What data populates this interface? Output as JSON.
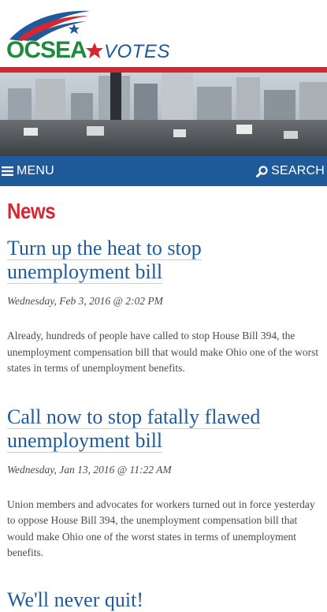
{
  "logo": {
    "text_left": "OCSEA",
    "text_right": "VOTES",
    "colors": {
      "blue": "#1f5b9a",
      "red": "#d7262f",
      "green": "#1f8a3b"
    }
  },
  "nav": {
    "menu_label": "MENU",
    "menu_icon": "hamburger-icon",
    "search_label": "SEARCH",
    "search_icon": "search-icon"
  },
  "section": {
    "title": "News"
  },
  "articles": [
    {
      "title": "Turn up the heat to stop unemployment bill",
      "date": "Wednesday, Feb 3, 2016 @ 2:02 PM",
      "summary": "Already, hundreds of people have called to stop House Bill 394, the unemployment compensation bill that would make Ohio one of the worst states in terms of unemployment benefits."
    },
    {
      "title": "Call now to stop fatally flawed unemployment bill",
      "date": "Wednesday, Jan 13, 2016 @ 11:22 AM",
      "summary": "Union members and advocates for workers turned out in force yesterday to oppose House Bill 394, the unemployment compensation bill that would make Ohio one of the worst states in terms of unemployment benefits."
    },
    {
      "title": "We'll never quit!"
    }
  ]
}
